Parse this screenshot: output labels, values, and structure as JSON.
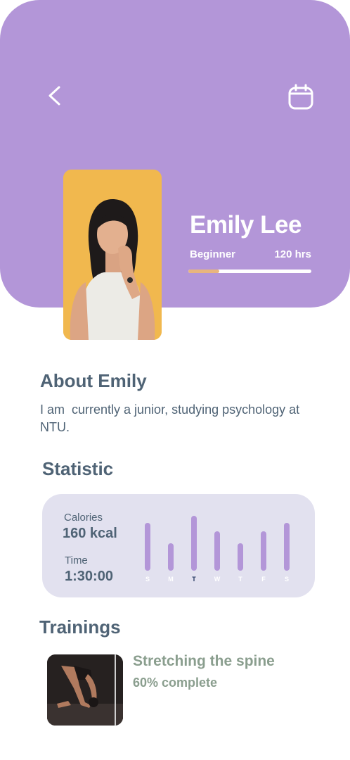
{
  "profile": {
    "name": "Emily Lee",
    "level": "Beginner",
    "hours": "120 hrs",
    "progress_fraction": 0.25,
    "colors": {
      "header": "#b396d8",
      "progress_fill": "#e8b57d",
      "progress_track": "#ffffff"
    }
  },
  "nav": {
    "back_icon": "chevron-left-icon",
    "calendar_icon": "calendar-icon"
  },
  "about": {
    "title": "About Emily",
    "text": "I am  currently a junior, studying psychology at NTU."
  },
  "statistic": {
    "title": "Statistic",
    "calories_label": "Calories",
    "calories_value": "160 kcal",
    "time_label": "Time",
    "time_value": "1:30:00",
    "days": [
      {
        "label": "S",
        "value": 0.64
      },
      {
        "label": "M",
        "value": 0.36
      },
      {
        "label": "T",
        "value": 0.73,
        "active": true
      },
      {
        "label": "W",
        "value": 0.52
      },
      {
        "label": "T",
        "value": 0.36
      },
      {
        "label": "F",
        "value": 0.52
      },
      {
        "label": "S",
        "value": 0.64
      }
    ]
  },
  "trainings": {
    "title": "Trainings",
    "items": [
      {
        "name": "Stretching the spine",
        "progress": "60% complete"
      }
    ]
  }
}
